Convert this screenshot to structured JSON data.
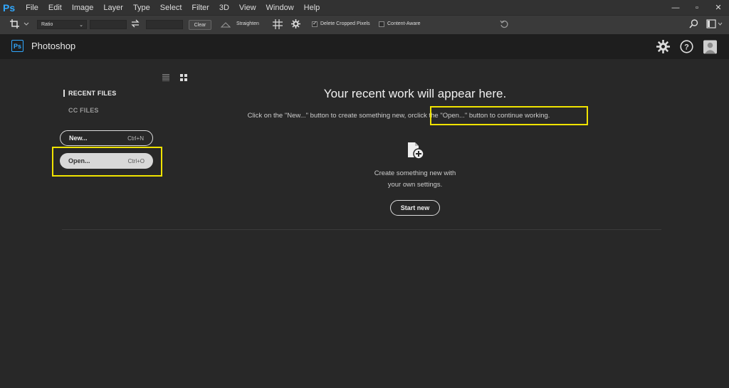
{
  "menubar": {
    "logo": "Ps",
    "items": [
      "File",
      "Edit",
      "Image",
      "Layer",
      "Type",
      "Select",
      "Filter",
      "3D",
      "View",
      "Window",
      "Help"
    ],
    "window_buttons": [
      "—",
      "▫",
      "✕"
    ]
  },
  "options": {
    "ratio_select": "Ratio",
    "clear_label": "Clear",
    "straighten_label": "Straighten",
    "delete_cropped_label": "Delete Cropped Pixels",
    "delete_cropped_checked": true,
    "content_aware_label": "Content-Aware",
    "content_aware_checked": false
  },
  "app": {
    "logo": "Ps",
    "title": "Photoshop"
  },
  "sidebar": {
    "recent_files": "RECENT FILES",
    "cc_files": "CC FILES",
    "new_label": "New...",
    "new_shortcut": "Ctrl+N",
    "open_label": "Open...",
    "open_shortcut": "Ctrl+O"
  },
  "main": {
    "headline": "Your recent work will appear here.",
    "subline_part1": "Click on the \"New...\" button to create something new, or",
    "subline_part2": "click the \"Open...\" button to continue working.",
    "create_line1": "Create something new with",
    "create_line2": "your own settings.",
    "start_new": "Start new"
  },
  "colors": {
    "accent": "#31a8ff",
    "highlight": "#f0e300",
    "background": "#282828"
  },
  "icons": [
    "crop-icon",
    "swap-icon",
    "level-icon",
    "grid-overlay-icon",
    "gear-icon",
    "reset-icon",
    "search-icon",
    "workspace-icon",
    "settings-icon",
    "help-icon",
    "avatar-icon",
    "list-view-icon",
    "grid-view-icon",
    "new-document-icon"
  ]
}
